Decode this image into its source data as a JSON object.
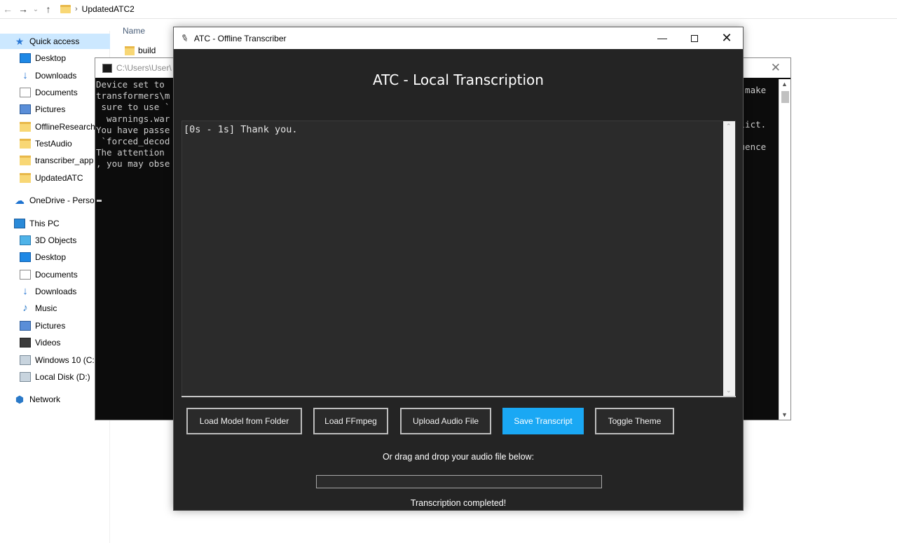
{
  "explorer": {
    "path": "UpdatedATC2",
    "column_name": "Name",
    "visible_folder": "build",
    "nav": [
      {
        "label": "Quick access",
        "icon": "star-icon"
      },
      {
        "label": "Desktop",
        "icon": "desktop-icon"
      },
      {
        "label": "Downloads",
        "icon": "download-icon"
      },
      {
        "label": "Documents",
        "icon": "document-icon"
      },
      {
        "label": "Pictures",
        "icon": "pictures-icon"
      },
      {
        "label": "OfflineResearch",
        "icon": "folder-icon"
      },
      {
        "label": "TestAudio",
        "icon": "folder-icon"
      },
      {
        "label": "transcriber_app",
        "icon": "folder-icon"
      },
      {
        "label": "UpdatedATC",
        "icon": "folder-icon"
      },
      {
        "label": "OneDrive - Person",
        "icon": "cloud-icon"
      },
      {
        "label": "This PC",
        "icon": "computer-icon"
      },
      {
        "label": "3D Objects",
        "icon": "cube-icon"
      },
      {
        "label": "Desktop",
        "icon": "desktop-icon"
      },
      {
        "label": "Documents",
        "icon": "document-icon"
      },
      {
        "label": "Downloads",
        "icon": "download-icon"
      },
      {
        "label": "Music",
        "icon": "music-icon"
      },
      {
        "label": "Pictures",
        "icon": "pictures-icon"
      },
      {
        "label": "Videos",
        "icon": "video-icon"
      },
      {
        "label": "Windows 10 (C:)",
        "icon": "drive-icon"
      },
      {
        "label": "Local Disk (D:)",
        "icon": "drive-icon"
      },
      {
        "label": "Network",
        "icon": "network-icon"
      }
    ]
  },
  "console": {
    "title": "C:\\Users\\User\\",
    "lines": [
      "Device set to ",
      "transformers\\m",
      " sure to use `",
      "  warnings.war",
      "You have passe",
      " `forced_decod",
      "The attention ",
      ", you may obse"
    ],
    "right_lines": [
      "e make",
      "",
      "",
      "flict.",
      "",
      "quence"
    ]
  },
  "app": {
    "window_title": "ATC - Offline Transcriber",
    "heading": "ATC - Local Transcription",
    "transcript": "[0s - 1s] Thank you.",
    "buttons": {
      "load_model": "Load Model from Folder",
      "load_ffmpeg": "Load FFmpeg",
      "upload_audio": "Upload Audio File",
      "save_transcript": "Save Transcript",
      "toggle_theme": "Toggle Theme"
    },
    "drop_hint": "Or drag and drop your audio file below:",
    "progress": 0,
    "status": "Transcription completed!",
    "accent_color": "#1aa8f4"
  }
}
